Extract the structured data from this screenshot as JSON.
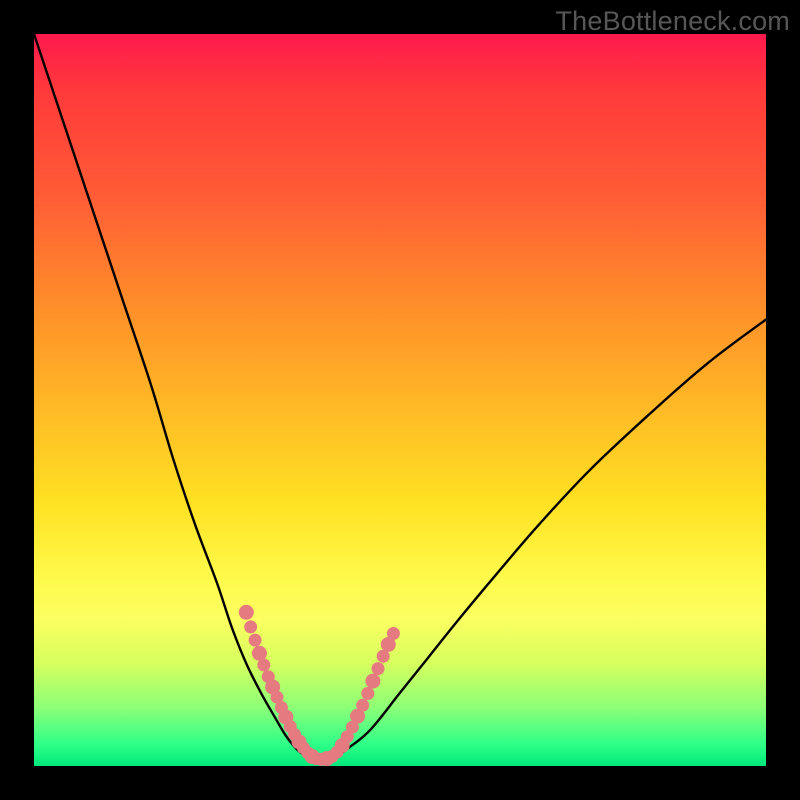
{
  "watermark": "TheBottleneck.com",
  "colors": {
    "frame": "#000000",
    "curve": "#000000",
    "marker": "#e57b80"
  },
  "chart_data": {
    "type": "line",
    "title": "",
    "xlabel": "",
    "ylabel": "",
    "xlim": [
      0,
      100
    ],
    "ylim": [
      0,
      100
    ],
    "grid": false,
    "legend_position": "none",
    "series": [
      {
        "name": "bottleneck_curve",
        "x": [
          0,
          4,
          8,
          12,
          16,
          19,
          22,
          25,
          27,
          29,
          31,
          33,
          34.5,
          36,
          37.5,
          39,
          41,
          43,
          46,
          50,
          54,
          58,
          63,
          69,
          76,
          84,
          92,
          100
        ],
        "y": [
          100,
          88,
          76,
          64,
          52,
          42,
          33,
          25,
          19,
          14,
          10,
          6.5,
          4,
          2.2,
          1.2,
          1,
          1.2,
          2.5,
          5,
          10,
          15,
          20,
          26,
          33,
          40.5,
          48,
          55,
          61
        ]
      }
    ],
    "marker_segments": {
      "left": [
        {
          "x": 29.0,
          "y": 21.0
        },
        {
          "x": 29.6,
          "y": 19.0
        },
        {
          "x": 30.2,
          "y": 17.2
        },
        {
          "x": 30.8,
          "y": 15.4
        },
        {
          "x": 31.4,
          "y": 13.8
        },
        {
          "x": 32.0,
          "y": 12.2
        },
        {
          "x": 32.6,
          "y": 10.8
        },
        {
          "x": 33.2,
          "y": 9.4
        },
        {
          "x": 33.8,
          "y": 8.0
        },
        {
          "x": 34.4,
          "y": 6.7
        },
        {
          "x": 35.0,
          "y": 5.4
        },
        {
          "x": 35.6,
          "y": 4.3
        },
        {
          "x": 36.2,
          "y": 3.3
        },
        {
          "x": 36.8,
          "y": 2.5
        },
        {
          "x": 37.4,
          "y": 1.8
        },
        {
          "x": 38.0,
          "y": 1.3
        },
        {
          "x": 38.6,
          "y": 1.0
        },
        {
          "x": 39.2,
          "y": 0.9
        }
      ],
      "right": [
        {
          "x": 40.0,
          "y": 1.0
        },
        {
          "x": 40.7,
          "y": 1.3
        },
        {
          "x": 41.4,
          "y": 1.9
        },
        {
          "x": 42.1,
          "y": 2.8
        },
        {
          "x": 42.8,
          "y": 4.0
        },
        {
          "x": 43.5,
          "y": 5.3
        },
        {
          "x": 44.2,
          "y": 6.8
        },
        {
          "x": 44.9,
          "y": 8.3
        },
        {
          "x": 45.6,
          "y": 9.9
        },
        {
          "x": 46.3,
          "y": 11.6
        },
        {
          "x": 47.0,
          "y": 13.3
        },
        {
          "x": 47.7,
          "y": 15.0
        },
        {
          "x": 48.4,
          "y": 16.6
        },
        {
          "x": 49.1,
          "y": 18.1
        }
      ]
    }
  }
}
